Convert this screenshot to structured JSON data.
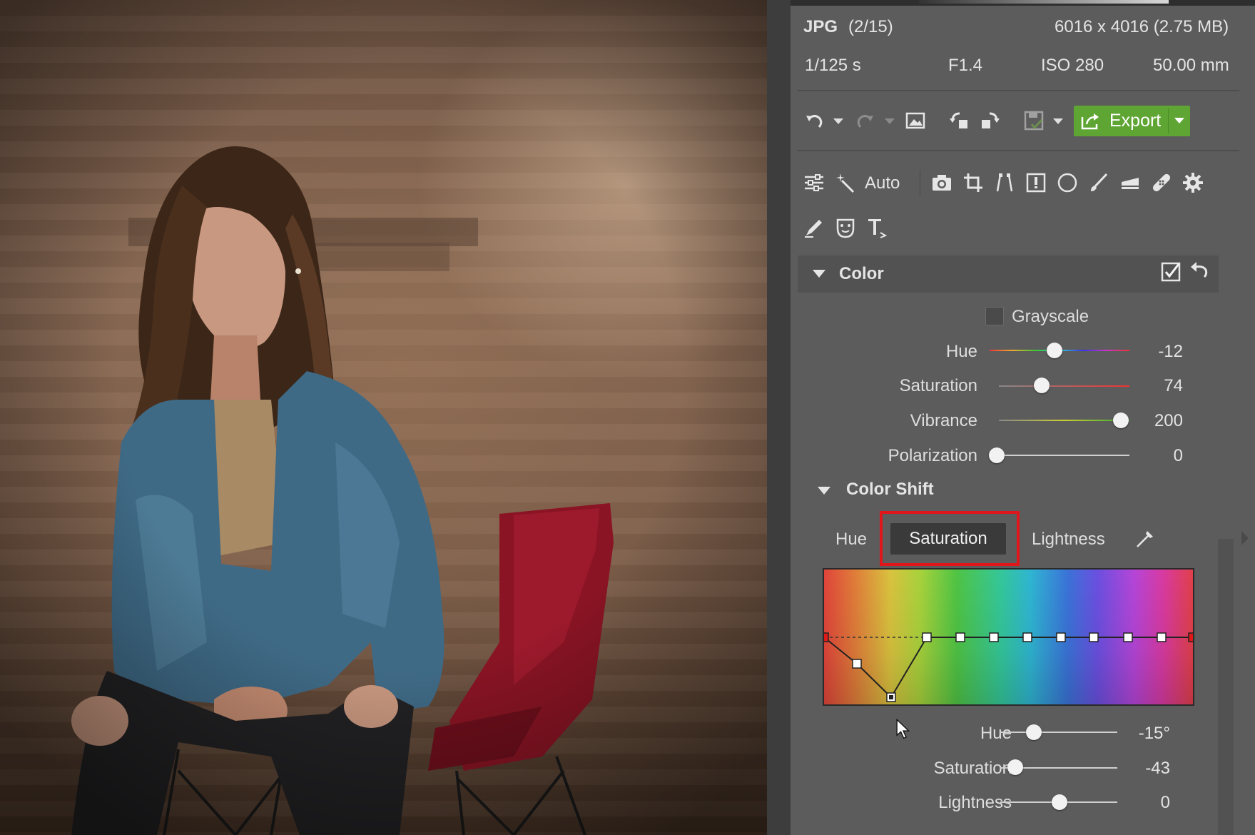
{
  "file_info": {
    "format": "JPG",
    "index": "(2/15)",
    "dimensions": "6016 x 4016 (2.75 MB)",
    "shutter": "1/125 s",
    "aperture": "F1.4",
    "iso": "ISO 280",
    "focal_length": "50.00 mm"
  },
  "toolbar": {
    "export_label": "Export",
    "auto_label": "Auto"
  },
  "color_section": {
    "title": "Color",
    "grayscale_label": "Grayscale",
    "grayscale_checked": false,
    "sliders": [
      {
        "label": "Hue",
        "value": "-12",
        "position": 0.47
      },
      {
        "label": "Saturation",
        "value": "74",
        "position": 0.37
      },
      {
        "label": "Vibrance",
        "value": "200",
        "position": 1.0
      },
      {
        "label": "Polarization",
        "value": "0",
        "position": 0.0
      }
    ]
  },
  "color_shift": {
    "title": "Color Shift",
    "tabs": [
      "Hue",
      "Saturation",
      "Lightness"
    ],
    "active_tab": "Saturation",
    "sliders": [
      {
        "label": "Hue",
        "value": "-15°",
        "position": 0.27
      },
      {
        "label": "Saturation",
        "value": "-43",
        "position": 0.12
      },
      {
        "label": "Lightness",
        "value": "0",
        "position": 0.5
      }
    ]
  },
  "colors": {
    "export_green": "#5fa534",
    "highlight_red": "#e0161b",
    "panel_bg": "#5c5c5c"
  }
}
